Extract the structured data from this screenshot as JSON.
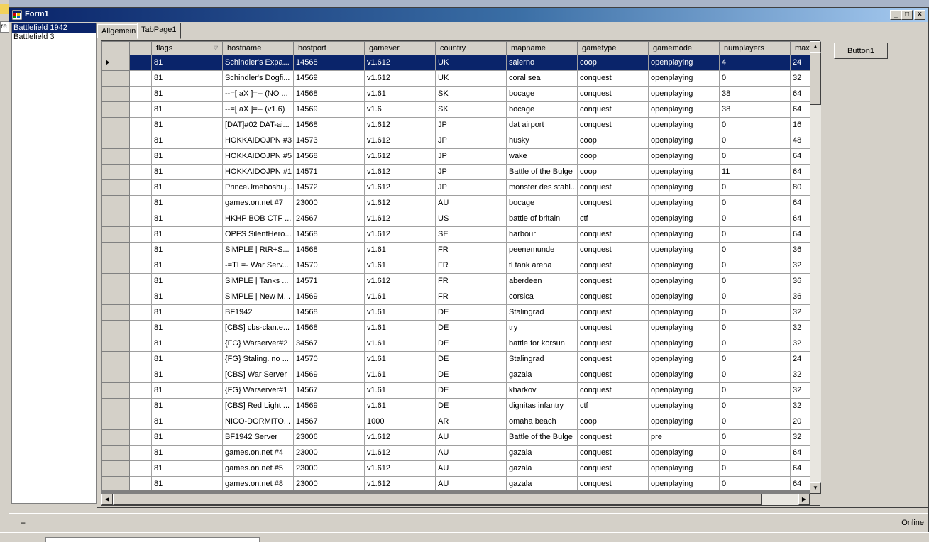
{
  "window": {
    "title": "Form1",
    "accent": "#0a246a"
  },
  "background_window": {
    "tab_fragment": "re"
  },
  "listbox": {
    "items": [
      "Battlefield 1942",
      "Battlefield 3"
    ],
    "selected_index": 0
  },
  "tabs": [
    {
      "label": "Allgemein"
    },
    {
      "label": "TabPage1"
    }
  ],
  "active_tab": 1,
  "grid": {
    "columns": [
      "",
      "flags",
      "hostname",
      "hostport",
      "gamever",
      "country",
      "mapname",
      "gametype",
      "gamemode",
      "numplayers",
      "max"
    ],
    "sorted_column": 1,
    "selected_row": 0,
    "rows": [
      [
        "",
        "81",
        "Schindler's Expa...",
        "14568",
        "v1.612",
        "UK",
        "salerno",
        "coop",
        "openplaying",
        "4",
        "24"
      ],
      [
        "",
        "81",
        "Schindler's Dogfi...",
        "14569",
        "v1.612",
        "UK",
        "coral sea",
        "conquest",
        "openplaying",
        "0",
        "32"
      ],
      [
        "",
        "81",
        "--=[ aX ]=-- (NO ...",
        "14568",
        "v1.61",
        "SK",
        "bocage",
        "conquest",
        "openplaying",
        "38",
        "64"
      ],
      [
        "",
        "81",
        "--=[ aX ]=-- (v1.6)",
        "14569",
        "v1.6",
        "SK",
        "bocage",
        "conquest",
        "openplaying",
        "38",
        "64"
      ],
      [
        "",
        "81",
        "[DAT]#02 DAT-ai...",
        "14568",
        "v1.612",
        "JP",
        "dat airport",
        "conquest",
        "openplaying",
        "0",
        "16"
      ],
      [
        "",
        "81",
        "HOKKAIDOJPN #3",
        "14573",
        "v1.612",
        "JP",
        "husky",
        "coop",
        "openplaying",
        "0",
        "48"
      ],
      [
        "",
        "81",
        "HOKKAIDOJPN #5",
        "14568",
        "v1.612",
        "JP",
        "wake",
        "coop",
        "openplaying",
        "0",
        "64"
      ],
      [
        "",
        "81",
        "HOKKAIDOJPN #1",
        "14571",
        "v1.612",
        "JP",
        "Battle of the Bulge",
        "coop",
        "openplaying",
        "11",
        "64"
      ],
      [
        "",
        "81",
        "PrinceUmeboshi.j...",
        "14572",
        "v1.612",
        "JP",
        "monster des stahl...",
        "conquest",
        "openplaying",
        "0",
        "80"
      ],
      [
        "",
        "81",
        "games.on.net #7",
        "23000",
        "v1.612",
        "AU",
        "bocage",
        "conquest",
        "openplaying",
        "0",
        "64"
      ],
      [
        "",
        "81",
        "HKHP BOB CTF ...",
        "24567",
        "v1.612",
        "US",
        "battle of britain",
        "ctf",
        "openplaying",
        "0",
        "64"
      ],
      [
        "",
        "81",
        "OPFS SilentHero...",
        "14568",
        "v1.612",
        "SE",
        "harbour",
        "conquest",
        "openplaying",
        "0",
        "64"
      ],
      [
        "",
        "81",
        "SiMPLE | RtR+S...",
        "14568",
        "v1.61",
        "FR",
        "peenemunde",
        "conquest",
        "openplaying",
        "0",
        "36"
      ],
      [
        "",
        "81",
        "-=TL=- War Serv...",
        "14570",
        "v1.61",
        "FR",
        "tl tank arena",
        "conquest",
        "openplaying",
        "0",
        "32"
      ],
      [
        "",
        "81",
        "SiMPLE | Tanks ...",
        "14571",
        "v1.612",
        "FR",
        "aberdeen",
        "conquest",
        "openplaying",
        "0",
        "36"
      ],
      [
        "",
        "81",
        "SiMPLE | New M...",
        "14569",
        "v1.61",
        "FR",
        "corsica",
        "conquest",
        "openplaying",
        "0",
        "36"
      ],
      [
        "",
        "81",
        "BF1942",
        "14568",
        "v1.61",
        "DE",
        "Stalingrad",
        "conquest",
        "openplaying",
        "0",
        "32"
      ],
      [
        "",
        "81",
        "[CBS] cbs-clan.e...",
        "14568",
        "v1.61",
        "DE",
        "try",
        "conquest",
        "openplaying",
        "0",
        "32"
      ],
      [
        "",
        "81",
        "{FG} Warserver#2",
        "34567",
        "v1.61",
        "DE",
        "battle for korsun",
        "conquest",
        "openplaying",
        "0",
        "32"
      ],
      [
        "",
        "81",
        "{FG} Staling. no ...",
        "14570",
        "v1.61",
        "DE",
        "Stalingrad",
        "conquest",
        "openplaying",
        "0",
        "24"
      ],
      [
        "",
        "81",
        "[CBS] War Server",
        "14569",
        "v1.61",
        "DE",
        "gazala",
        "conquest",
        "openplaying",
        "0",
        "32"
      ],
      [
        "",
        "81",
        "{FG} Warserver#1",
        "14567",
        "v1.61",
        "DE",
        "kharkov",
        "conquest",
        "openplaying",
        "0",
        "32"
      ],
      [
        "",
        "81",
        "[CBS] Red Light ...",
        "14569",
        "v1.61",
        "DE",
        "dignitas infantry",
        "ctf",
        "openplaying",
        "0",
        "32"
      ],
      [
        "",
        "81",
        "NICO-DORMITO...",
        "14567",
        "1000",
        "AR",
        "omaha beach",
        "coop",
        "openplaying",
        "0",
        "20"
      ],
      [
        "",
        "81",
        "BF1942 Server",
        "23006",
        "v1.612",
        "AU",
        "Battle of the Bulge",
        "conquest",
        "pre",
        "0",
        "32"
      ],
      [
        "",
        "81",
        "games.on.net #4",
        "23000",
        "v1.612",
        "AU",
        "gazala",
        "conquest",
        "openplaying",
        "0",
        "64"
      ],
      [
        "",
        "81",
        "games.on.net #5",
        "23000",
        "v1.612",
        "AU",
        "gazala",
        "conquest",
        "openplaying",
        "0",
        "64"
      ],
      [
        "",
        "81",
        "games.on.net #8",
        "23000",
        "v1.612",
        "AU",
        "gazala",
        "conquest",
        "openplaying",
        "0",
        "64"
      ]
    ]
  },
  "button1": {
    "label": "Button1"
  },
  "statusbar": {
    "left": "+",
    "right": "Online"
  },
  "icons": {
    "minimize": "minimize-icon",
    "maximize": "maximize-icon",
    "close": "close-icon",
    "sort": "sort-arrow-icon",
    "row_pointer": "row-pointer-icon"
  }
}
